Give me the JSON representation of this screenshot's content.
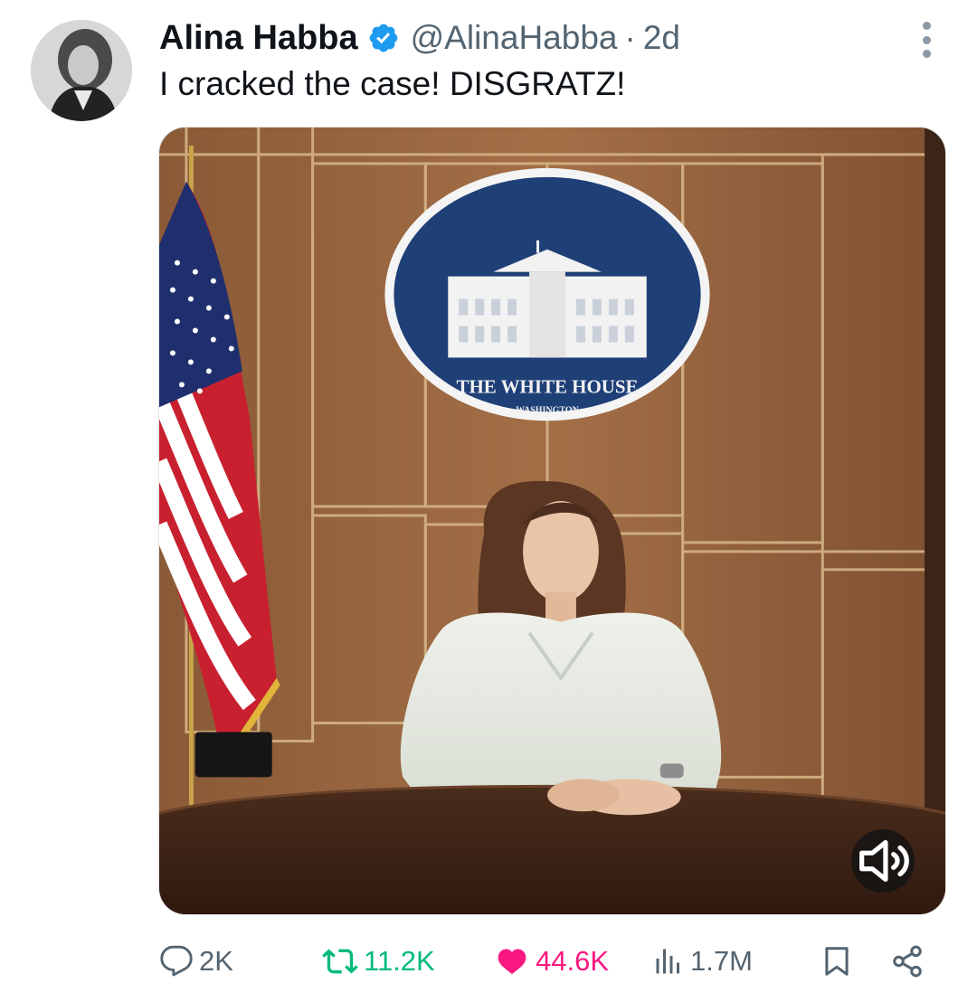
{
  "tweet": {
    "display_name": "Alina Habba",
    "handle": "@AlinaHabba",
    "separator": "·",
    "time": "2d",
    "text": "I cracked the case! DISGRATZ!",
    "media": {
      "seal_title": "THE WHITE HOUSE",
      "seal_subtitle": "WASHINGTON"
    }
  },
  "actions": {
    "replies": "2K",
    "retweets": "11.2K",
    "likes": "44.6K",
    "views": "1.7M"
  },
  "colors": {
    "verified_blue": "#1d9bf0",
    "retweet_green": "#00ba7c",
    "like_pink": "#f91880",
    "muted_gray": "#536471"
  },
  "icons": [
    "verified-badge-icon",
    "more-icon",
    "speaker-icon",
    "reply-icon",
    "retweet-icon",
    "heart-icon",
    "views-icon",
    "bookmark-icon",
    "share-icon"
  ]
}
